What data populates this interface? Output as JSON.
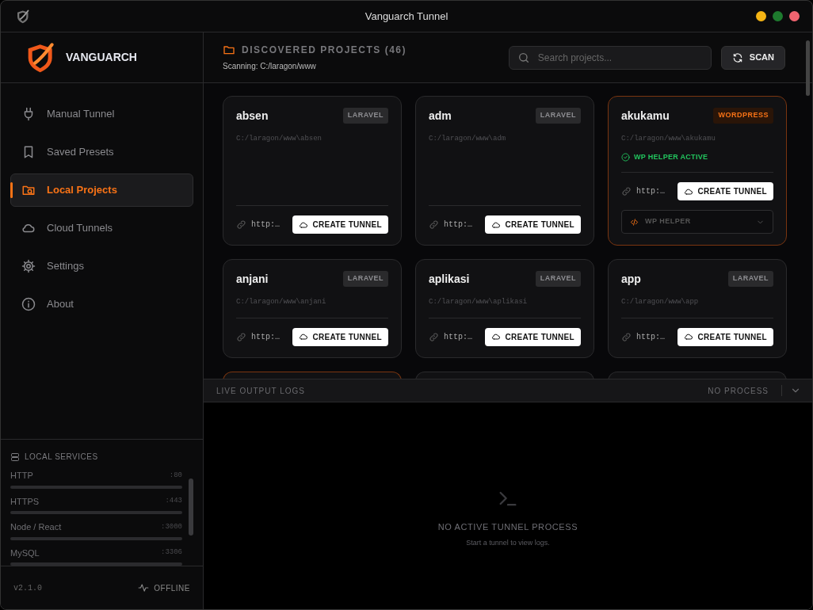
{
  "window": {
    "title": "Vanguarch Tunnel"
  },
  "brand": "VANGUARCH",
  "sidebar": {
    "items": [
      {
        "label": "Manual Tunnel",
        "selected": false
      },
      {
        "label": "Saved Presets",
        "selected": false
      },
      {
        "label": "Local Projects",
        "selected": true
      },
      {
        "label": "Cloud Tunnels",
        "selected": false
      },
      {
        "label": "Settings",
        "selected": false
      },
      {
        "label": "About",
        "selected": false
      }
    ],
    "services_title": "LOCAL SERVICES",
    "services": [
      {
        "name": "HTTP",
        "port": ":80"
      },
      {
        "name": "HTTPS",
        "port": ":443"
      },
      {
        "name": "Node / React",
        "port": ":3000"
      },
      {
        "name": "MySQL",
        "port": ":3306"
      }
    ],
    "version": "v2.1.0",
    "status": "OFFLINE"
  },
  "header": {
    "title": "DISCOVERED PROJECTS (46)",
    "subtitle": "Scanning: C:/laragon/www",
    "search_placeholder": "Search projects...",
    "scan_button": "SCAN"
  },
  "projects": [
    {
      "name": "absen",
      "kind": "laravel",
      "badge": "LARAVEL",
      "path": "C:/laragon/www\\absen",
      "url": "http:…",
      "button": "CREATE TUNNEL"
    },
    {
      "name": "adm",
      "kind": "laravel",
      "badge": "LARAVEL",
      "path": "C:/laragon/www\\adm",
      "url": "http:…",
      "button": "CREATE TUNNEL"
    },
    {
      "name": "akukamu",
      "kind": "wordpress",
      "badge": "WORDPRESS",
      "path": "C:/laragon/www\\akukamu",
      "helper_status": "WP HELPER ACTIVE",
      "url": "http:…",
      "button": "CREATE TUNNEL",
      "helper_menu": "WP HELPER"
    },
    {
      "name": "anjani",
      "kind": "laravel",
      "badge": "LARAVEL",
      "path": "C:/laragon/www\\anjani",
      "url": "http:…",
      "button": "CREATE TUNNEL"
    },
    {
      "name": "aplikasi",
      "kind": "laravel",
      "badge": "LARAVEL",
      "path": "C:/laragon/www\\aplikasi",
      "url": "http:…",
      "button": "CREATE TUNNEL"
    },
    {
      "name": "app",
      "kind": "laravel",
      "badge": "LARAVEL",
      "path": "C:/laragon/www\\app",
      "url": "http:…",
      "button": "CREATE TUNNEL"
    }
  ],
  "clipped_projects": [
    {
      "kind": "wordpress"
    },
    {
      "kind": "laravel"
    },
    {
      "kind": "laravel"
    }
  ],
  "logs": {
    "title": "LIVE OUTPUT LOGS",
    "status": "NO PROCESS",
    "empty_title": "NO ACTIVE TUNNEL PROCESS",
    "empty_hint": "Start a tunnel to view logs."
  }
}
